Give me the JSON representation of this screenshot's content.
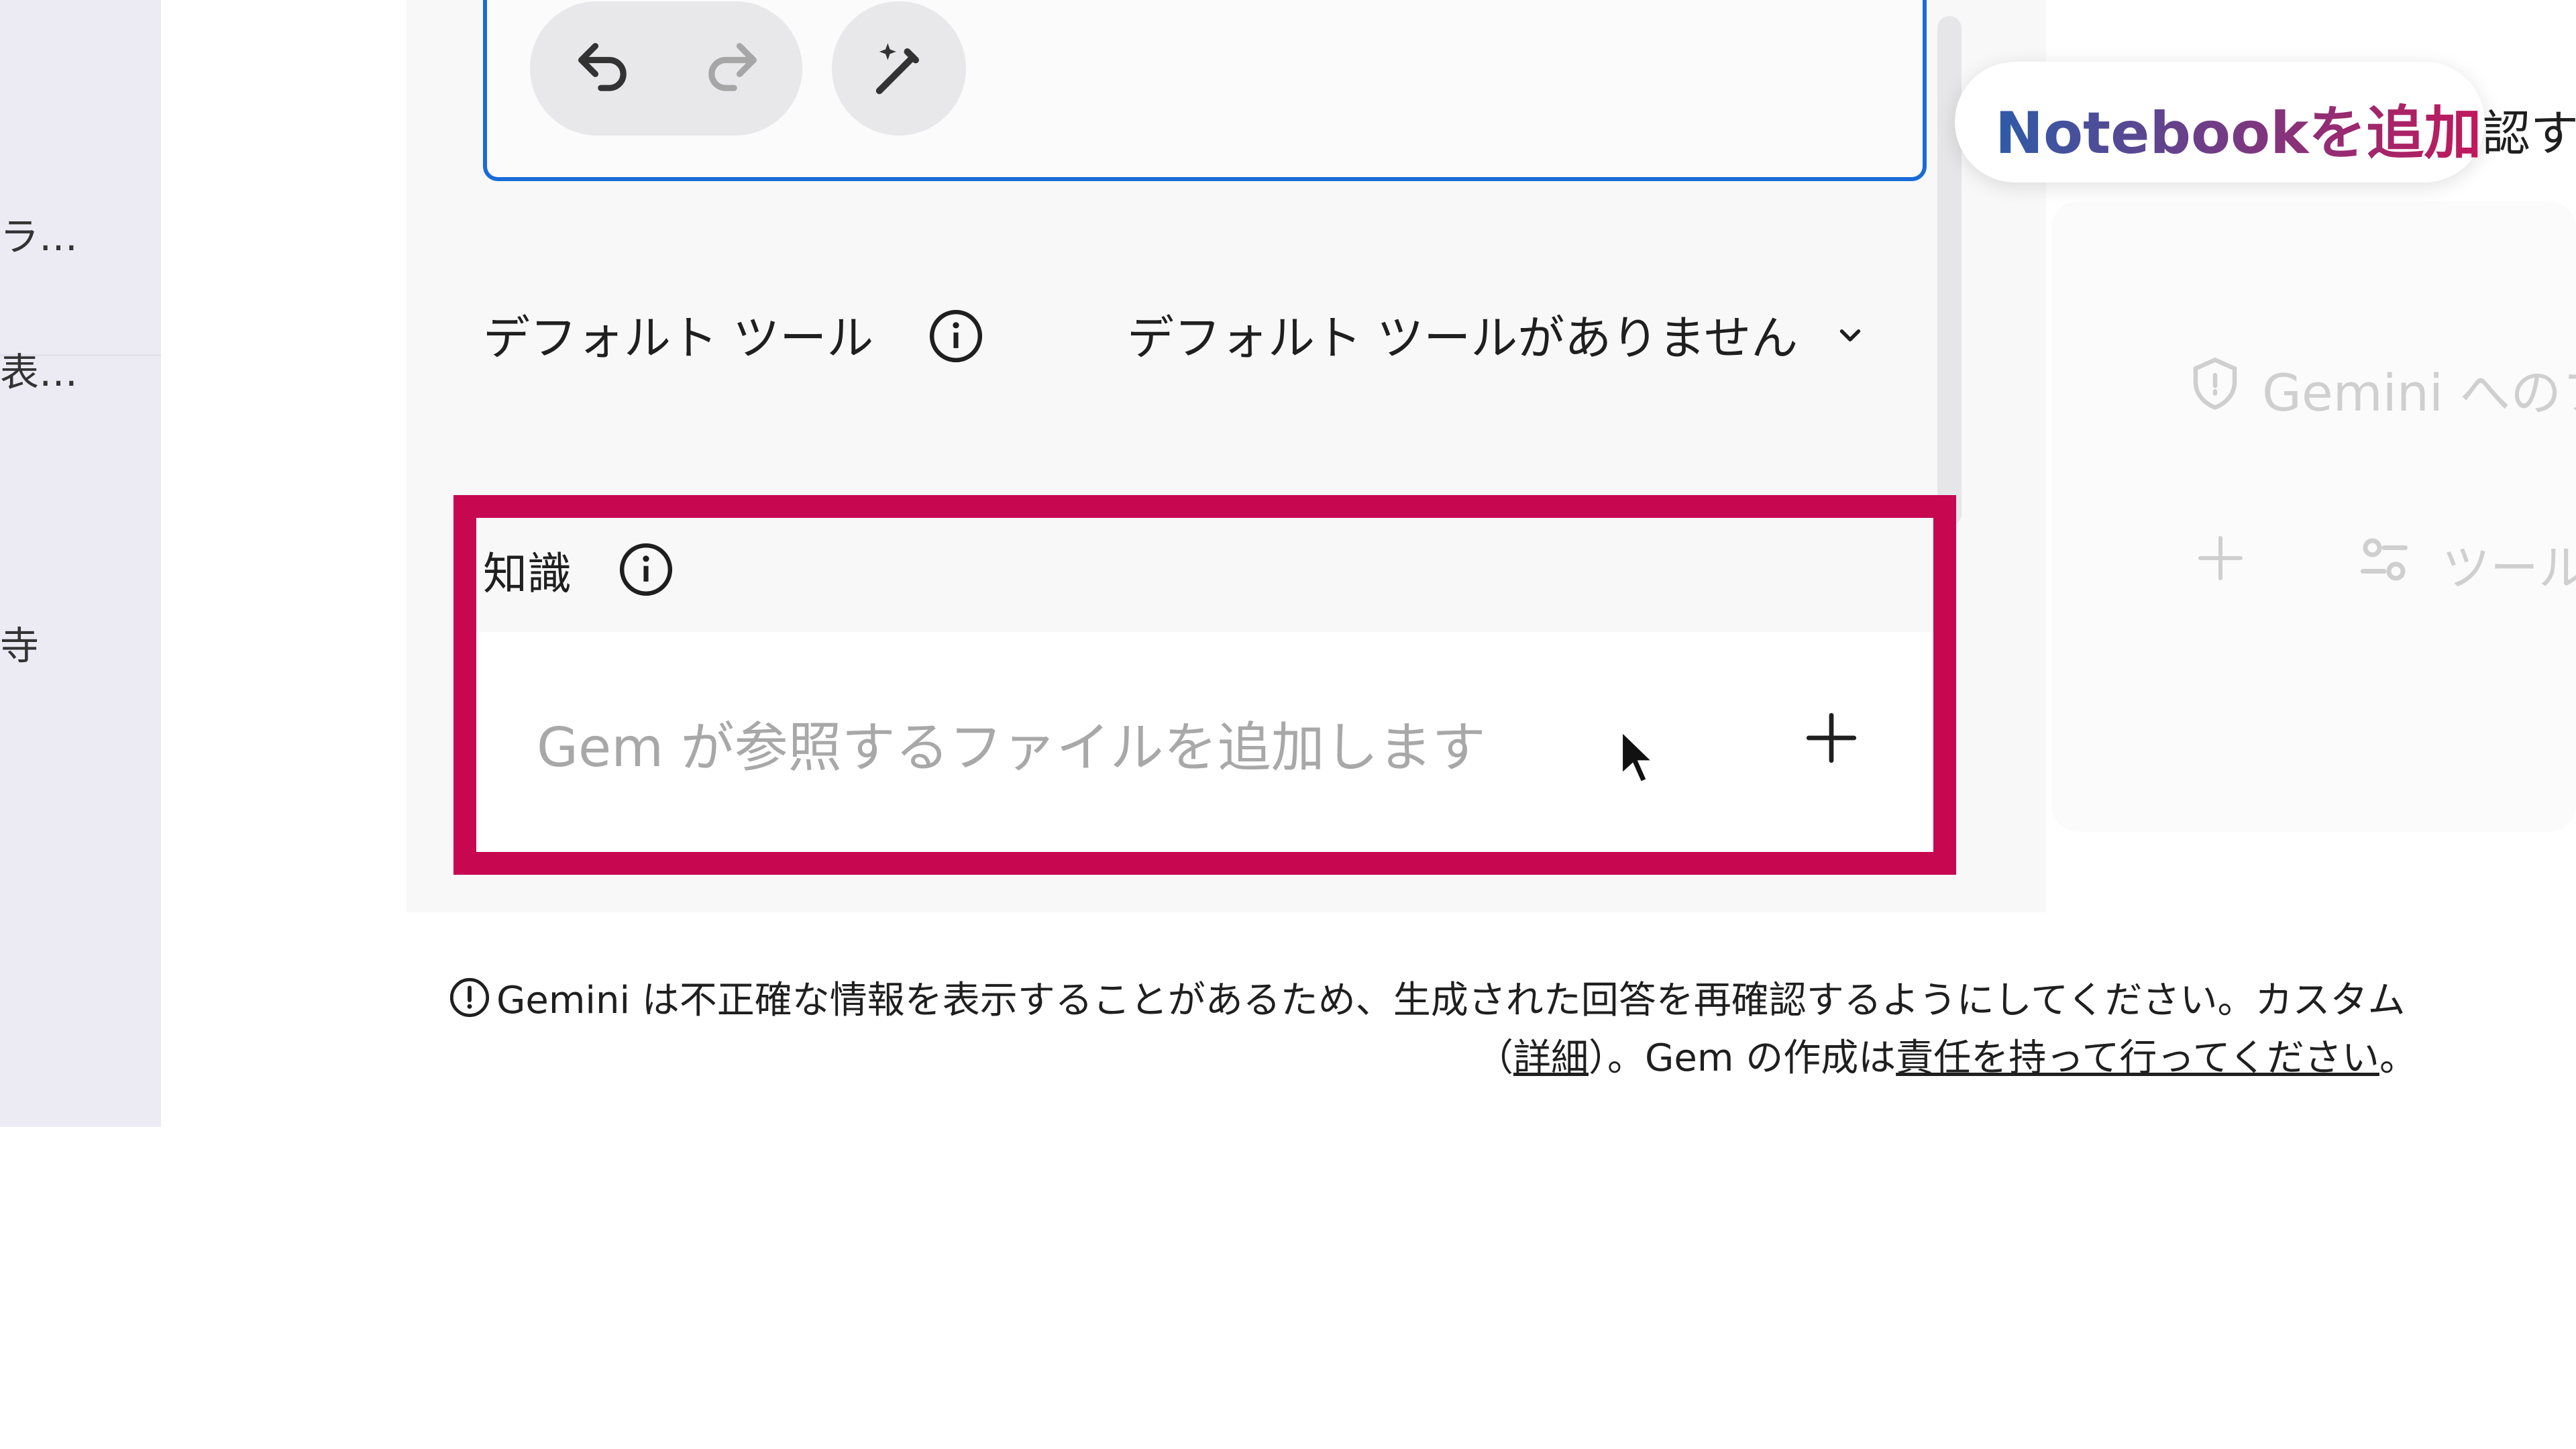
{
  "sidebar": {
    "items": [
      {
        "label": "ラ…"
      },
      {
        "label": "表…"
      },
      {
        "label": "寺"
      }
    ]
  },
  "editor": {
    "undo_icon": "undo-icon",
    "redo_icon": "redo-icon",
    "magic_icon": "magic-wand-pen-icon"
  },
  "default_tools": {
    "label": "デフォルト ツール",
    "value": "デフォルト ツールがありません"
  },
  "knowledge": {
    "label": "知識",
    "placeholder": "Gem が参照するファイルを追加します"
  },
  "right_panel": {
    "chip": "Notebookを追加",
    "cut_text": "認す",
    "privacy_text": "Gemini へのフ",
    "tools_text": "ツール"
  },
  "disclaimer": {
    "line1": "Gemini は不正確な情報を表示することがあるため、生成された回答を再確認するようにしてください。カスタム",
    "paren_open": "（",
    "details_link": "詳細",
    "middle": "）。Gem の作成は",
    "responsibility_link": "責任を持って行ってください",
    "end": "。"
  },
  "colors": {
    "highlight": "#c70750",
    "editor_border": "#1a6ad8"
  }
}
